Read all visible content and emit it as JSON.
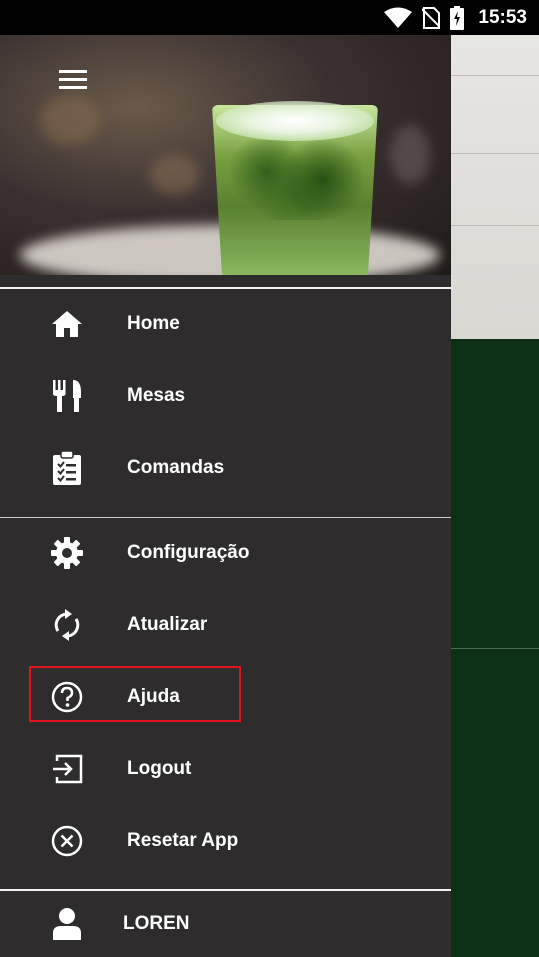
{
  "status_bar": {
    "time": "15:53",
    "icons": [
      "wifi-icon",
      "no-sim-icon",
      "battery-charging-icon"
    ]
  },
  "drawer": {
    "header_icon": "hamburger-menu-icon",
    "sections": [
      {
        "items": [
          {
            "label": "Home",
            "icon": "home-icon"
          },
          {
            "label": "Mesas",
            "icon": "fork-knife-icon"
          },
          {
            "label": "Comandas",
            "icon": "clipboard-checklist-icon"
          }
        ]
      },
      {
        "items": [
          {
            "label": "Configuração",
            "icon": "gear-icon"
          },
          {
            "label": "Atualizar",
            "icon": "refresh-icon"
          },
          {
            "label": "Ajuda",
            "icon": "help-circle-icon",
            "highlighted": true
          },
          {
            "label": "Logout",
            "icon": "logout-icon"
          },
          {
            "label": "Resetar App",
            "icon": "close-circle-icon"
          }
        ]
      }
    ],
    "user": {
      "name": "LOREN",
      "icon": "user-icon"
    }
  },
  "colors": {
    "drawer_bg": "#2e2c2c",
    "background_green": "#0b3015",
    "highlight_border": "#e0141c",
    "text": "#ffffff"
  }
}
